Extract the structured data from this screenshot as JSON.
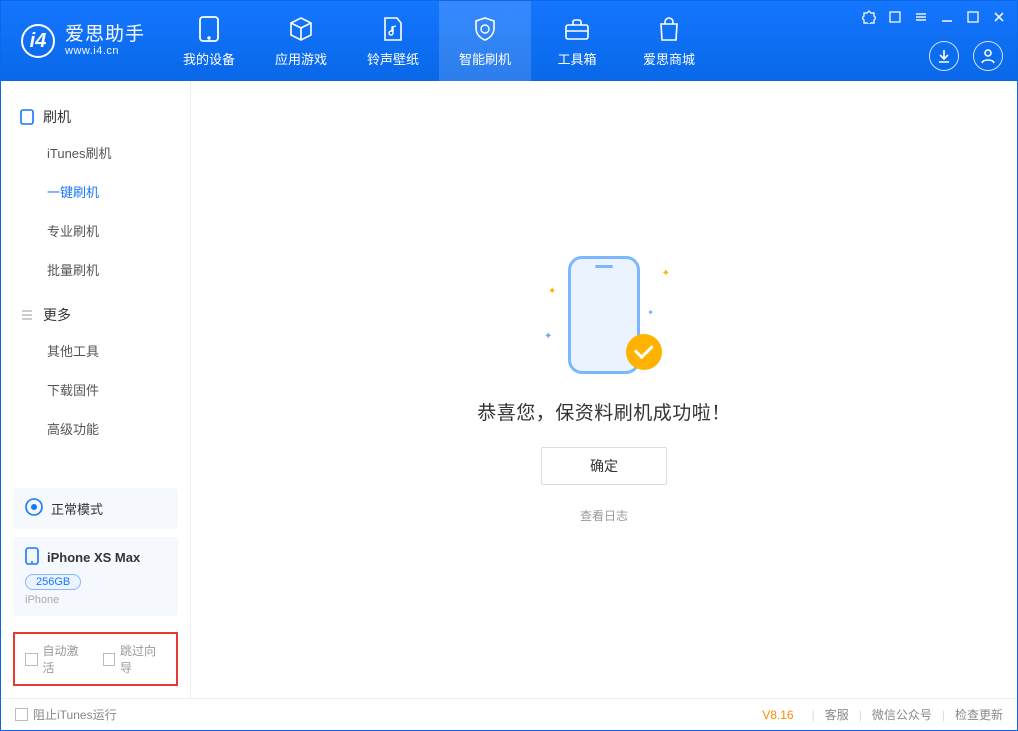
{
  "app": {
    "name": "爱思助手",
    "domain": "www.i4.cn"
  },
  "nav": {
    "items": [
      {
        "label": "我的设备"
      },
      {
        "label": "应用游戏"
      },
      {
        "label": "铃声壁纸"
      },
      {
        "label": "智能刷机"
      },
      {
        "label": "工具箱"
      },
      {
        "label": "爱思商城"
      }
    ]
  },
  "sidebar": {
    "section1": {
      "title": "刷机",
      "items": [
        "iTunes刷机",
        "一键刷机",
        "专业刷机",
        "批量刷机"
      ]
    },
    "section2": {
      "title": "更多",
      "items": [
        "其他工具",
        "下载固件",
        "高级功能"
      ]
    },
    "options": {
      "auto_activate": "自动激活",
      "skip_guide": "跳过向导"
    }
  },
  "device": {
    "status": "正常模式",
    "name": "iPhone XS Max",
    "storage": "256GB",
    "type": "iPhone"
  },
  "main": {
    "success_msg": "恭喜您，保资料刷机成功啦！",
    "ok_btn": "确定",
    "log_link": "查看日志"
  },
  "footer": {
    "block_itunes": "阻止iTunes运行",
    "version": "V8.16",
    "links": [
      "客服",
      "微信公众号",
      "检查更新"
    ]
  }
}
